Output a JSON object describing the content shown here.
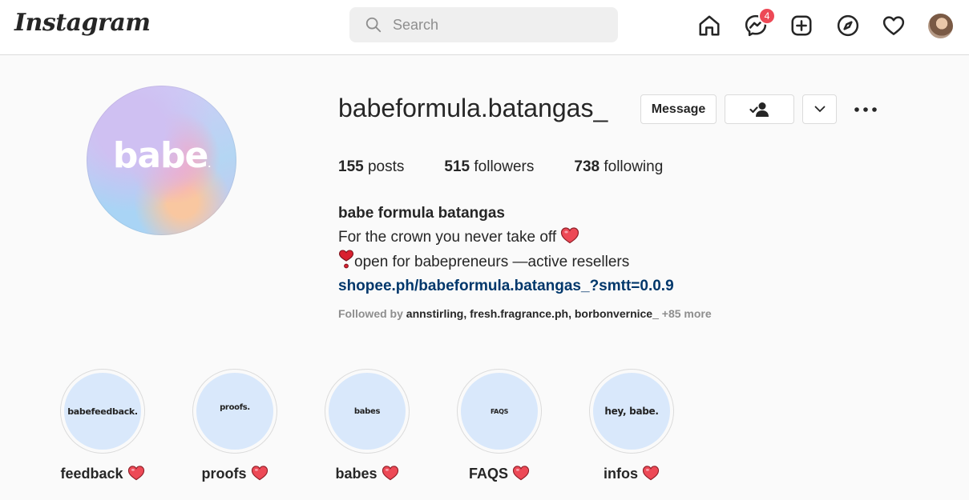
{
  "nav": {
    "logo": "Instagram",
    "search_placeholder": "Search",
    "messenger_badge": "4",
    "icons": [
      "home-icon",
      "messenger-icon",
      "new-post-icon",
      "explore-icon",
      "activity-heart-icon",
      "profile-avatar"
    ]
  },
  "profile": {
    "picture_text": "babe",
    "username": "babeformula.batangas_",
    "message_label": "Message",
    "stats": {
      "posts_count": "155",
      "posts_label": "posts",
      "followers_count": "515",
      "followers_label": "followers",
      "following_count": "738",
      "following_label": "following"
    },
    "bio": {
      "full_name": "babe formula batangas",
      "line1": "For the crown you never take off",
      "line2": "open for babepreneurs —active resellers",
      "link": "shopee.ph/babeformula.batangas_?smtt=0.0.9"
    },
    "followed_by": {
      "prefix": "Followed by",
      "names": [
        "annstirling",
        "fresh.fragrance.ph",
        "borbonvernice_"
      ],
      "more": "+85 more"
    }
  },
  "highlights": [
    {
      "cover_text": "babefeedback.",
      "label": "feedback"
    },
    {
      "cover_text": "proofs.",
      "label": "proofs"
    },
    {
      "cover_text": "babes",
      "label": "babes"
    },
    {
      "cover_text": "FAQS",
      "label": "FAQS"
    },
    {
      "cover_text": "hey, babe.",
      "label": "infos"
    }
  ],
  "colors": {
    "badge": "#ed4956",
    "link": "#00376b",
    "highlight_bg": "#d9e8fb",
    "heart": "#ed4956"
  }
}
